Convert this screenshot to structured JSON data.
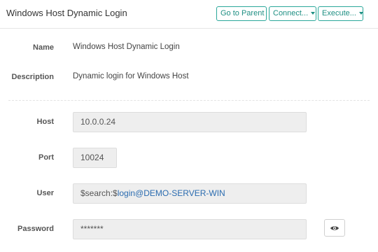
{
  "header": {
    "title": "Windows Host Dynamic Login",
    "buttons": {
      "go_to_parent": "Go to Parent",
      "connect": "Connect...",
      "execute": "Execute..."
    }
  },
  "details": {
    "name_label": "Name",
    "name_value": "Windows Host Dynamic Login",
    "description_label": "Description",
    "description_value": "Dynamic login for Windows Host"
  },
  "fields": {
    "host_label": "Host",
    "host_value": "10.0.0.24",
    "port_label": "Port",
    "port_value": "10024",
    "user_label": "User",
    "user_prefix": "$search:$",
    "user_accent": "login@DEMO-SERVER-WIN",
    "password_label": "Password",
    "password_value": "*******"
  },
  "icons": {
    "caret": "caret-down-icon",
    "reveal": "eye-icon"
  },
  "colors": {
    "accent": "#2aa89a",
    "link": "#2b6cb0",
    "field_bg": "#eeeeee"
  }
}
